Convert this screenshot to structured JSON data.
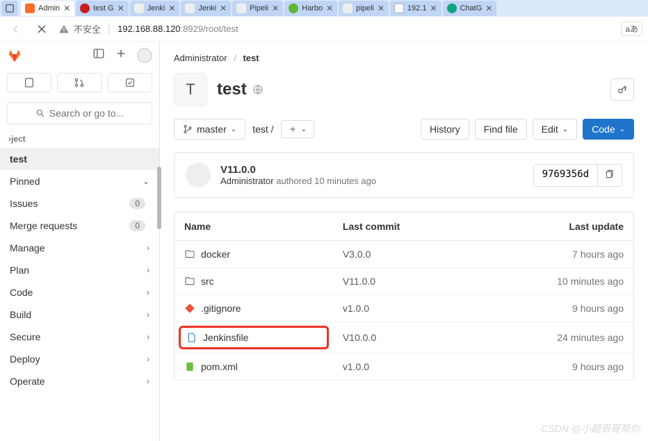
{
  "browser": {
    "tabs": [
      {
        "label": "Admin",
        "iconClass": "orange",
        "active": true
      },
      {
        "label": "test G",
        "iconClass": "gitee"
      },
      {
        "label": "Jenki",
        "iconClass": "jenkins"
      },
      {
        "label": "Jenki",
        "iconClass": "jenkins"
      },
      {
        "label": "Pipeli",
        "iconClass": "jenkins"
      },
      {
        "label": "Harbo",
        "iconClass": "harbor"
      },
      {
        "label": "pipeli",
        "iconClass": "jenkins"
      },
      {
        "label": "192.1",
        "iconClass": "page"
      },
      {
        "label": "ChatG",
        "iconClass": "gpt"
      }
    ],
    "insecure_label": "不安全",
    "url_host": "192.168.88.120",
    "url_rest": ":8929/root/test",
    "lang": "aあ"
  },
  "sidebar": {
    "search_placeholder": "Search or go to...",
    "section_label": "›ject",
    "project_item": "test",
    "pinned": "Pinned",
    "items": [
      {
        "label": "Issues",
        "count": "0"
      },
      {
        "label": "Merge requests",
        "count": "0"
      }
    ],
    "menu": [
      "Manage",
      "Plan",
      "Code",
      "Build",
      "Secure",
      "Deploy",
      "Operate"
    ]
  },
  "breadcrumb": {
    "root": "Administrator",
    "sep": "/",
    "leaf": "test"
  },
  "project": {
    "initial": "T",
    "name": "test"
  },
  "actions": {
    "branch": "master",
    "path": "test /",
    "history": "History",
    "find_file": "Find file",
    "edit": "Edit",
    "code": "Code"
  },
  "commit": {
    "title": "V11.0.0",
    "author": "Administrator",
    "verb": "authored",
    "time": "10 minutes ago",
    "sha": "9769356d"
  },
  "table": {
    "headers": {
      "name": "Name",
      "commit": "Last commit",
      "update": "Last update"
    },
    "rows": [
      {
        "type": "folder",
        "name": "docker",
        "commit": "V3.0.0",
        "update": "7 hours ago"
      },
      {
        "type": "folder",
        "name": "src",
        "commit": "V11.0.0",
        "update": "10 minutes ago"
      },
      {
        "type": "gitignore",
        "name": ".gitignore",
        "commit": "v1.0.0",
        "update": "9 hours ago"
      },
      {
        "type": "file",
        "name": "Jenkinsfile",
        "commit": "V10.0.0",
        "update": "24 minutes ago",
        "highlight": true
      },
      {
        "type": "xml",
        "name": "pom.xml",
        "commit": "v1.0.0",
        "update": "9 hours ago"
      }
    ]
  },
  "watermark": "CSDN @小超哥哥帮你"
}
